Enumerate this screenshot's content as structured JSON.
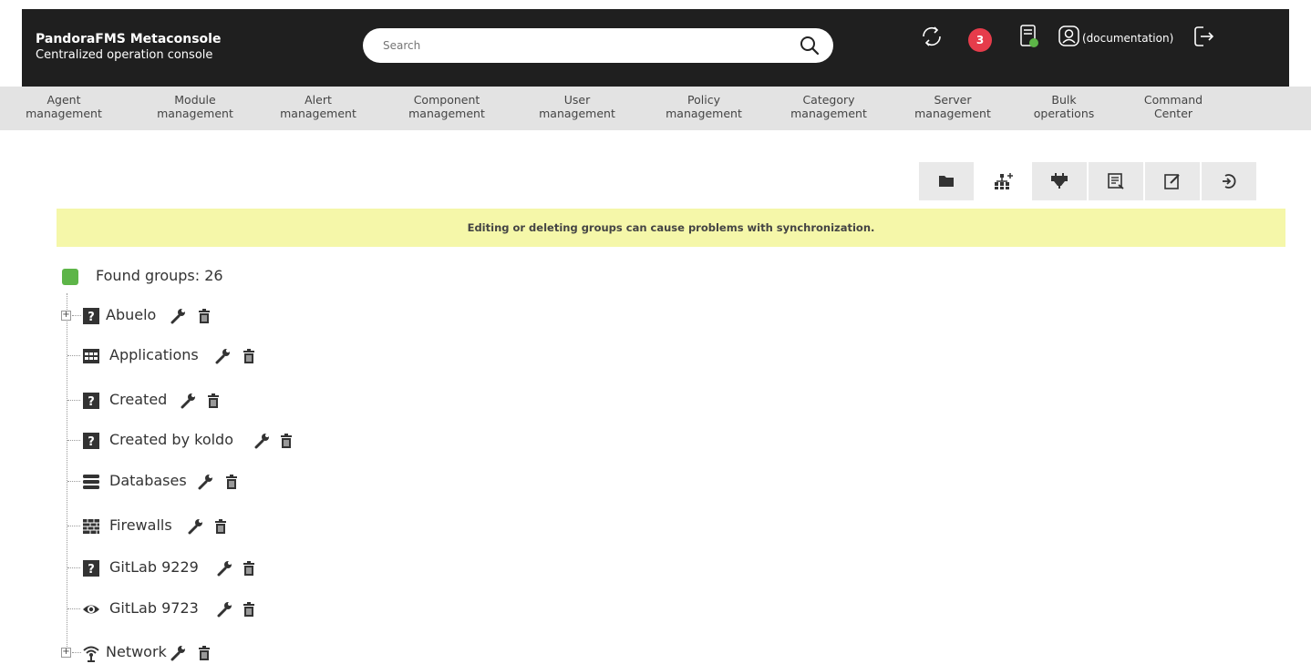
{
  "header": {
    "app_title": "PandoraFMS Metaconsole",
    "app_subtitle": "Centralized operation console",
    "search_placeholder": "Search",
    "notification_count": "3",
    "user_label": "(documentation)"
  },
  "nav": {
    "items": [
      {
        "line1": "Agent",
        "line2": "management"
      },
      {
        "line1": "Module",
        "line2": "management"
      },
      {
        "line1": "Alert",
        "line2": "management"
      },
      {
        "line1": "Component",
        "line2": "management"
      },
      {
        "line1": "User",
        "line2": "management"
      },
      {
        "line1": "Policy",
        "line2": "management"
      },
      {
        "line1": "Category",
        "line2": "management"
      },
      {
        "line1": "Server",
        "line2": "management"
      },
      {
        "line1": "Bulk",
        "line2": "operations"
      },
      {
        "line1": "Command",
        "line2": "Center"
      }
    ]
  },
  "toolbar": {
    "buttons": [
      "folder-icon",
      "tree-icon",
      "plug-icon",
      "report-icon",
      "edit-icon",
      "exit-icon"
    ],
    "active_index": 1
  },
  "warning": {
    "text": "Editing or deleting groups can cause problems with synchronization."
  },
  "tree": {
    "found_label": "Found groups: 26",
    "groups": [
      {
        "name": "Abuelo",
        "icon": "question-icon",
        "expandable": true
      },
      {
        "name": "Applications",
        "icon": "calculator-icon",
        "expandable": false
      },
      {
        "name": "Created",
        "icon": "question-icon",
        "expandable": false
      },
      {
        "name": "Created by koldo",
        "icon": "question-icon",
        "expandable": false
      },
      {
        "name": "Databases",
        "icon": "database-icon",
        "expandable": false
      },
      {
        "name": "Firewalls",
        "icon": "firewall-icon",
        "expandable": false
      },
      {
        "name": "GitLab 9229",
        "icon": "question-icon",
        "expandable": false
      },
      {
        "name": "GitLab 9723",
        "icon": "eye-icon",
        "expandable": false
      },
      {
        "name": "Network",
        "icon": "wifi-icon",
        "expandable": true
      }
    ]
  },
  "colors": {
    "header_bg": "#1f1f1f",
    "nav_bg": "#e3e3e3",
    "warning_bg": "#f5f7a9",
    "badge": "#e63c4b",
    "status_green": "#5db548"
  }
}
